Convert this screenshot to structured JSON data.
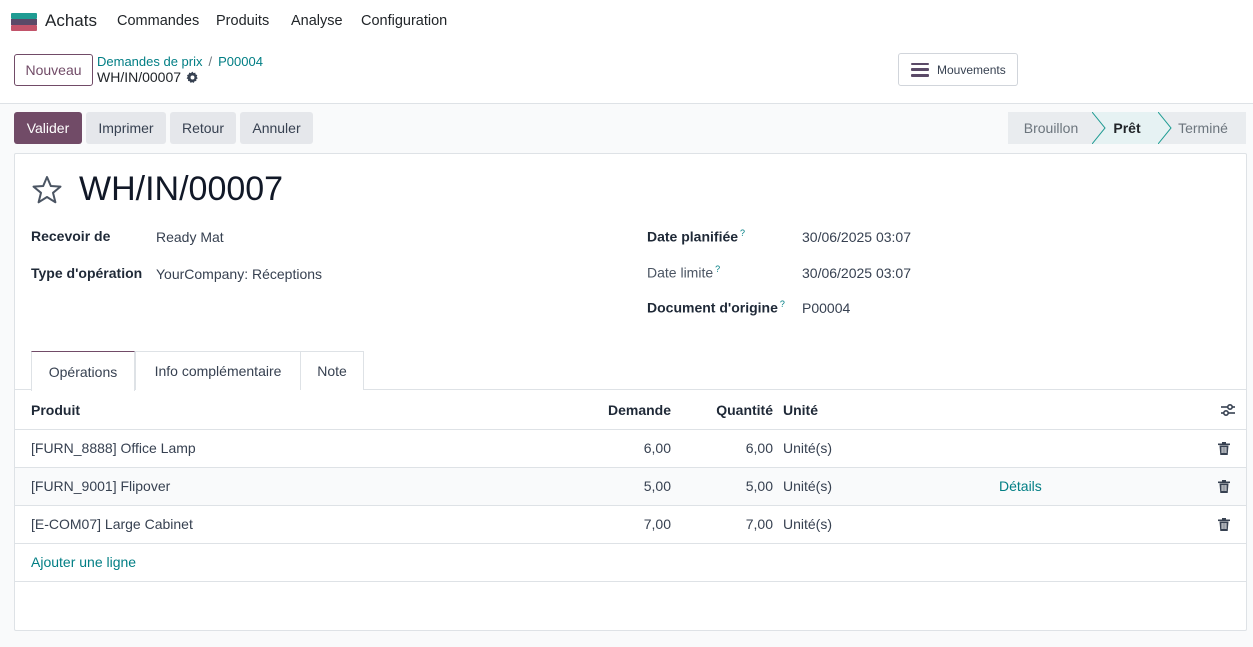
{
  "topnav": {
    "app_name": "Achats",
    "menu": [
      "Commandes",
      "Produits",
      "Analyse",
      "Configuration"
    ]
  },
  "control": {
    "new_label": "Nouveau",
    "breadcrumb": [
      "Demandes de prix",
      "P00004"
    ],
    "current": "WH/IN/00007",
    "moves_label": "Mouvements"
  },
  "actions": [
    "Valider",
    "Imprimer",
    "Retour",
    "Annuler"
  ],
  "status": {
    "steps": [
      "Brouillon",
      "Prêt",
      "Terminé"
    ],
    "active": "Prêt"
  },
  "form": {
    "title": "WH/IN/00007",
    "receive_from_label": "Recevoir de",
    "receive_from": "Ready Mat",
    "op_type_label": "Type d'opération",
    "op_type": "YourCompany: Réceptions",
    "scheduled_label": "Date planifiée",
    "scheduled": "30/06/2025 03:07",
    "deadline_label": "Date limite",
    "deadline": "30/06/2025 03:07",
    "origin_label": "Document d'origine",
    "origin": "P00004",
    "help_mark": "?"
  },
  "tabs": [
    "Opérations",
    "Info complémentaire",
    "Note"
  ],
  "table": {
    "headers": [
      "Produit",
      "Demande",
      "Quantité",
      "Unité"
    ],
    "rows": [
      {
        "product": "[FURN_8888] Office Lamp",
        "demand": "6,00",
        "qty": "6,00",
        "uom": "Unité(s)",
        "details": ""
      },
      {
        "product": "[FURN_9001] Flipover",
        "demand": "5,00",
        "qty": "5,00",
        "uom": "Unité(s)",
        "details": "Détails"
      },
      {
        "product": "[E-COM07] Large Cabinet",
        "demand": "7,00",
        "qty": "7,00",
        "uom": "Unité(s)",
        "details": ""
      }
    ],
    "add_line": "Ajouter une ligne"
  },
  "colors": {
    "brand": "#714b67",
    "link": "#017e84"
  }
}
